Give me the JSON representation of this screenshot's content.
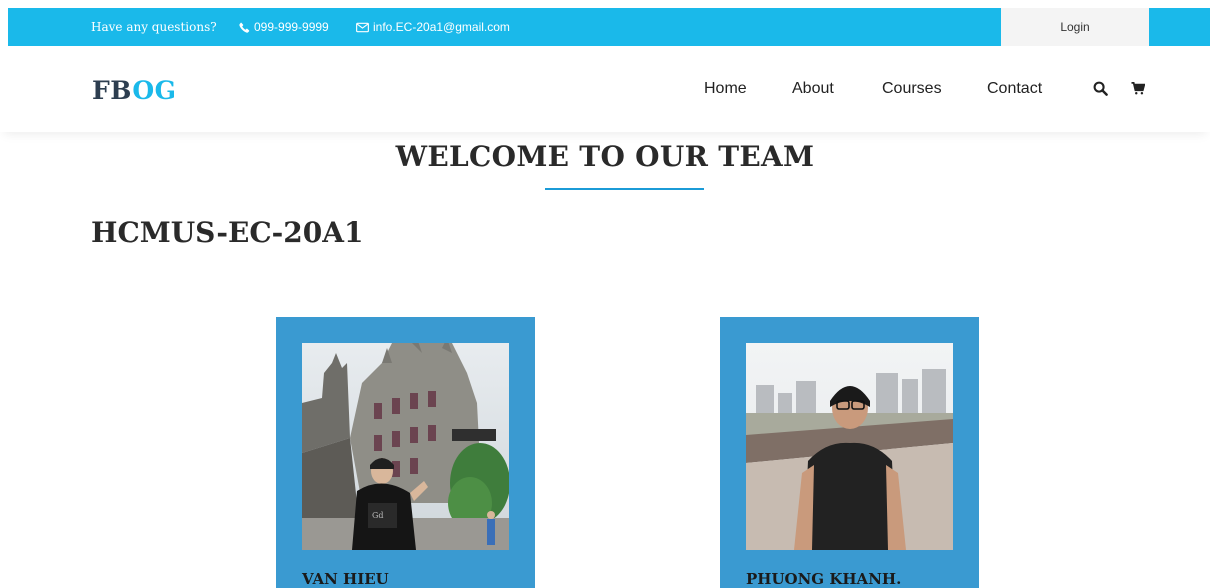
{
  "topbar": {
    "question": "Have any questions?",
    "phone": "099-999-9999",
    "email": "info.EC-20a1@gmail.com",
    "login_label": "Login"
  },
  "header": {
    "logo_part1": "FB",
    "logo_part2": "OG",
    "nav": [
      "Home",
      "About",
      "Courses",
      "Contact"
    ]
  },
  "main": {
    "welcome_title": "WELCOME TO OUR TEAM",
    "team_name": "HCMUS-EC-20A1",
    "members": [
      {
        "name": "VAN HIEU"
      },
      {
        "name": "PHUONG KHANH."
      }
    ]
  },
  "colors": {
    "topbar": "#1ab9ea",
    "accent": "#1b9bd7",
    "card": "#3a9ad1",
    "logo_dark": "#2d3e50"
  }
}
